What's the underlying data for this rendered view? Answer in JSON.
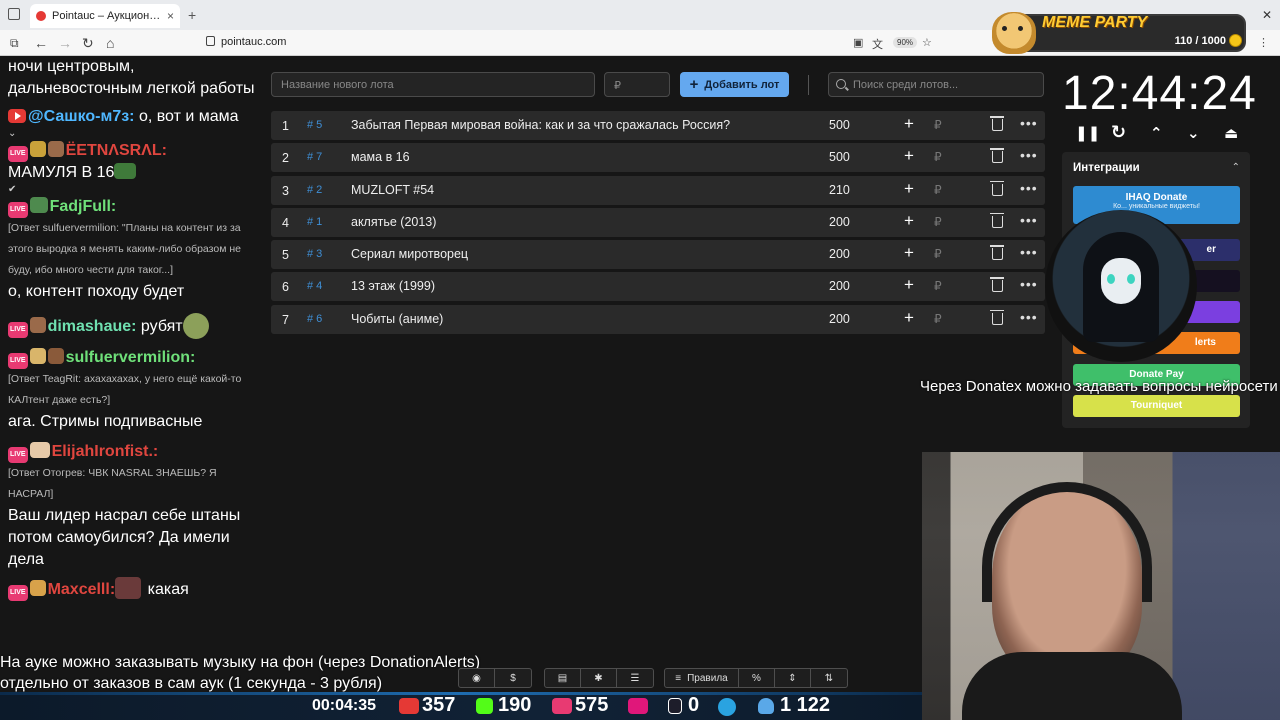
{
  "browser": {
    "tab_title": "Pointauc – Аукционы, лотереи",
    "url": "pointauc.com",
    "zoom": "90%"
  },
  "overlay": {
    "meme_title": "MEME PARTY",
    "meme_score": "110 / 1000"
  },
  "chat": {
    "messages": [
      {
        "text": "ночи центровым, дальневосточным легкой работы"
      },
      {
        "nick": "@Сашко-м7з:",
        "text": " о, вот и мама"
      },
      {
        "nick": "ЁЕТNΛSRΛL:",
        "text": "МАМУЛЯ В 16"
      },
      {
        "nick": "FadjFull:",
        "reply": "[Ответ sulfuervermilion: \"Планы на контент из за этого выродка я менять каким-либо образом не буду, ибо много чести для таког...]",
        "text": "о, контент походу будет"
      },
      {
        "nick": "dimashaue:",
        "text": " рубят"
      },
      {
        "nick": "sulfuervermilion:",
        "reply": "[Ответ TeagRit: ахахахахах, у него ещё какой-то КАЛтент даже есть?]",
        "text": "ага. Стримы подпивасные"
      },
      {
        "nick": "ElijahIronfist.:",
        "reply": "[Ответ Отогрев: ЧВК NASRAL ЗНАЕШЬ? Я НАСРАЛ]",
        "text": "Ваш лидер насрал себе штаны потом самоубился? Да имели дела"
      },
      {
        "nick": "Maxcelll:",
        "text": " какая"
      }
    ]
  },
  "toolbar": {
    "lot_placeholder": "Название нового лота",
    "price_placeholder": "₽",
    "add_label": "Добавить лот",
    "search_placeholder": "Поиск среди лотов..."
  },
  "lots": [
    {
      "num": "1",
      "id": "# 5",
      "name": "Забытая Первая мировая война: как и за что сражалась Россия?",
      "amount": "500"
    },
    {
      "num": "2",
      "id": "# 7",
      "name": "мама в 16",
      "amount": "500"
    },
    {
      "num": "3",
      "id": "# 2",
      "name": "MUZLOFT #54",
      "amount": "210"
    },
    {
      "num": "4",
      "id": "# 1",
      "name": "аклятье (2013)",
      "amount": "200"
    },
    {
      "num": "5",
      "id": "# 3",
      "name": "Сериал миротворец",
      "amount": "200"
    },
    {
      "num": "6",
      "id": "# 4",
      "name": "13 этаж (1999)",
      "amount": "200"
    },
    {
      "num": "7",
      "id": "# 6",
      "name": "Чобиты (аниме)",
      "amount": "200"
    }
  ],
  "currency_symbol": "₽",
  "timer": {
    "value": "12:44:24"
  },
  "integrations": {
    "title": "Интеграции",
    "ihaq": "IHAQ Donate",
    "ihaq_sub": "Ко... уникальные виджеты!",
    "donate_partial": "er",
    "alerts_partial": "lerts",
    "donatepay": "Donate Pay",
    "tourniquet": "Tourniquet"
  },
  "captions": {
    "top": "Через Donatex можно задавать вопросы нейросети",
    "bottom_1": "На ауке можно заказывать музыку на фон (через DonationAlerts)",
    "bottom_2": "отдельно от заказов в сам аук (1 секунда - 3 рубля)"
  },
  "bottom_toolbar": {
    "rules_label": "Правила"
  },
  "stats": {
    "uptime": "00:04:35",
    "youtube": "357",
    "kick": "190",
    "vk": "575",
    "rutube": "0",
    "viewers": "1 122"
  },
  "colors": {
    "accent": "#64a8ef",
    "id_blue": "#3f8fd6",
    "ihaq": "#2e8bd1",
    "donatepay": "#3fbf6a",
    "tourniquet": "#d7e14a",
    "alerts": "#f07d1a",
    "purple": "#7b3fe0"
  }
}
